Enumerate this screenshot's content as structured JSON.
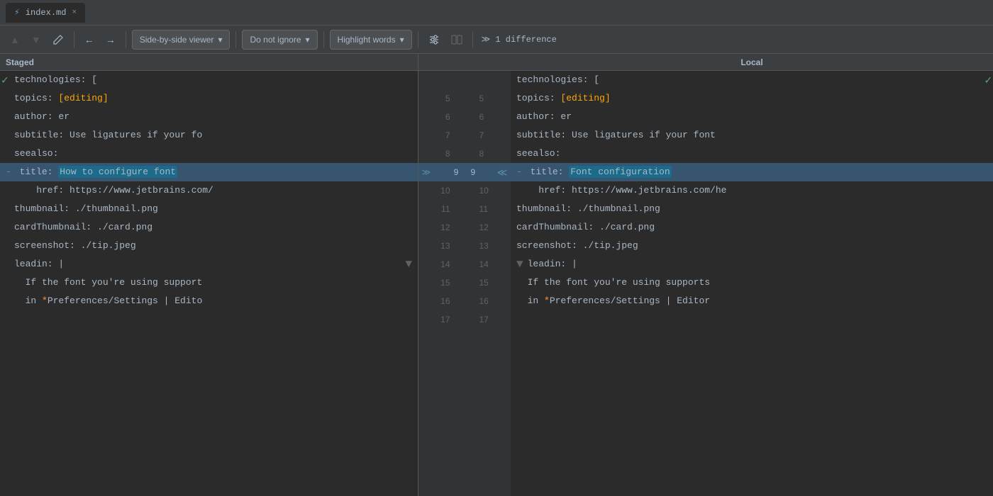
{
  "tab": {
    "icon": "⚡",
    "label": "index.md",
    "close": "×"
  },
  "toolbar": {
    "up_label": "▲",
    "down_label": "▼",
    "edit_label": "✏",
    "back_label": "←",
    "forward_label": "→",
    "viewer_dropdown": "Side-by-side viewer",
    "ignore_dropdown": "Do not ignore",
    "highlight_dropdown": "Highlight words",
    "settings_label": "⚙",
    "columns_label": "⊞",
    "difference_label": "≫  1 difference"
  },
  "staged_header": "Staged",
  "local_header": "Local",
  "lines": [
    {
      "num": "",
      "left": "technologies: [",
      "right": "technologies: ["
    },
    {
      "num": 5,
      "left": "topics: [editing]",
      "right": "topics: [editing]",
      "left_type": "topics",
      "right_type": "topics"
    },
    {
      "num": 6,
      "left": "author: er",
      "right": "author: er"
    },
    {
      "num": 7,
      "left": "subtitle: Use ligatures if your fo",
      "right": "subtitle: Use ligatures if your font"
    },
    {
      "num": 8,
      "left": "seealso:",
      "right": "seealso:"
    },
    {
      "num": 9,
      "left": "- title: How to configure font",
      "right": "- title: Font configuration",
      "changed": true
    },
    {
      "num": 10,
      "left": "    href: https://www.jetbrains.com/",
      "right": "    href: https://www.jetbrains.com/he"
    },
    {
      "num": 11,
      "left": "thumbnail: ./thumbnail.png",
      "right": "thumbnail: ./thumbnail.png"
    },
    {
      "num": 12,
      "left": "cardThumbnail: ./card.png",
      "right": "cardThumbnail: ./card.png"
    },
    {
      "num": 13,
      "left": "screenshot: ./tip.jpeg",
      "right": "screenshot: ./tip.jpeg"
    },
    {
      "num": 14,
      "left": "leadin: |",
      "right": "leadin: |",
      "collapse_left": true,
      "collapse_right": true
    },
    {
      "num": 15,
      "left": "  If the font you're using support",
      "right": "  If the font you're using supports"
    },
    {
      "num": 16,
      "left": "  in *Preferences/Settings | Edito",
      "right": "  in *Preferences/Settings | Editor"
    },
    {
      "num": 17,
      "left": "",
      "right": ""
    }
  ]
}
